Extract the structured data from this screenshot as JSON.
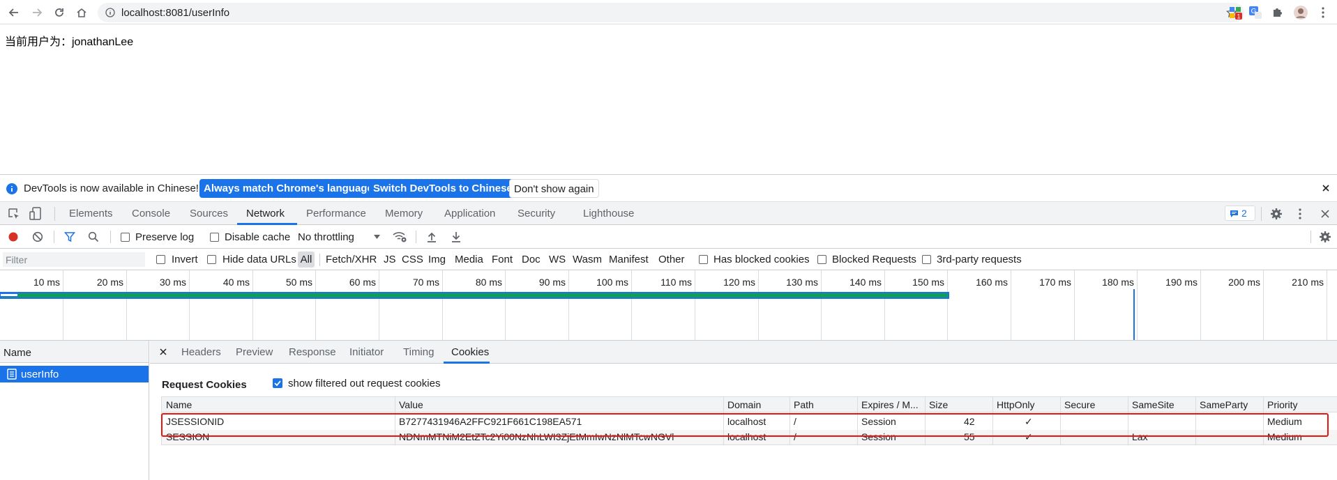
{
  "browser": {
    "url": "localhost:8081/userInfo",
    "extension_badge": "1"
  },
  "page": {
    "text": "当前用户为：jonathanLee"
  },
  "infobar": {
    "message": "DevTools is now available in Chinese!",
    "btn_match": "Always match Chrome's language",
    "btn_switch": "Switch DevTools to Chinese",
    "btn_dont_show": "Don't show again"
  },
  "devtools": {
    "tabs": [
      "Elements",
      "Console",
      "Sources",
      "Network",
      "Performance",
      "Memory",
      "Application",
      "Security",
      "Lighthouse"
    ],
    "active_tab": "Network",
    "issues_count": "2"
  },
  "toolbar": {
    "preserve_log": "Preserve log",
    "disable_cache": "Disable cache",
    "throttling": "No throttling"
  },
  "filter": {
    "placeholder": "Filter",
    "invert": "Invert",
    "hide_data_urls": "Hide data URLs",
    "types": [
      "All",
      "Fetch/XHR",
      "JS",
      "CSS",
      "Img",
      "Media",
      "Font",
      "Doc",
      "WS",
      "Wasm",
      "Manifest",
      "Other"
    ],
    "has_blocked_cookies": "Has blocked cookies",
    "blocked_requests": "Blocked Requests",
    "third_party": "3rd-party requests"
  },
  "timeline": {
    "ticks": [
      "10 ms",
      "20 ms",
      "30 ms",
      "40 ms",
      "50 ms",
      "60 ms",
      "70 ms",
      "80 ms",
      "90 ms",
      "100 ms",
      "110 ms",
      "120 ms",
      "130 ms",
      "140 ms",
      "150 ms",
      "160 ms",
      "170 ms",
      "180 ms",
      "190 ms",
      "200 ms",
      "210 ms"
    ]
  },
  "requests": {
    "header": "Name",
    "items": [
      "userInfo"
    ]
  },
  "detail": {
    "tabs": [
      "Headers",
      "Preview",
      "Response",
      "Initiator",
      "Timing",
      "Cookies"
    ],
    "active_tab": "Cookies",
    "section_title": "Request Cookies",
    "show_filtered": "show filtered out request cookies",
    "columns": [
      "Name",
      "Value",
      "Domain",
      "Path",
      "Expires / M...",
      "Size",
      "HttpOnly",
      "Secure",
      "SameSite",
      "SameParty",
      "Priority"
    ],
    "rows": [
      [
        "JSESSIONID",
        "B7277431946A2FFC921F661C198EA571",
        "localhost",
        "/",
        "Session",
        "42",
        "✓",
        "",
        "",
        "",
        "Medium"
      ],
      [
        "SESSION",
        "NDNmMTNiM2EtZTc2Yi00NzNhLWI3ZjEtMmIwNzNlMTcwNGVl",
        "localhost",
        "/",
        "Session",
        "55",
        "✓",
        "",
        "Lax",
        "",
        "Medium"
      ]
    ]
  },
  "colors": {
    "accent": "#1a73e8",
    "highlight": "#e8140e",
    "record": "#d93025",
    "waterfall": "#0f9d58"
  }
}
